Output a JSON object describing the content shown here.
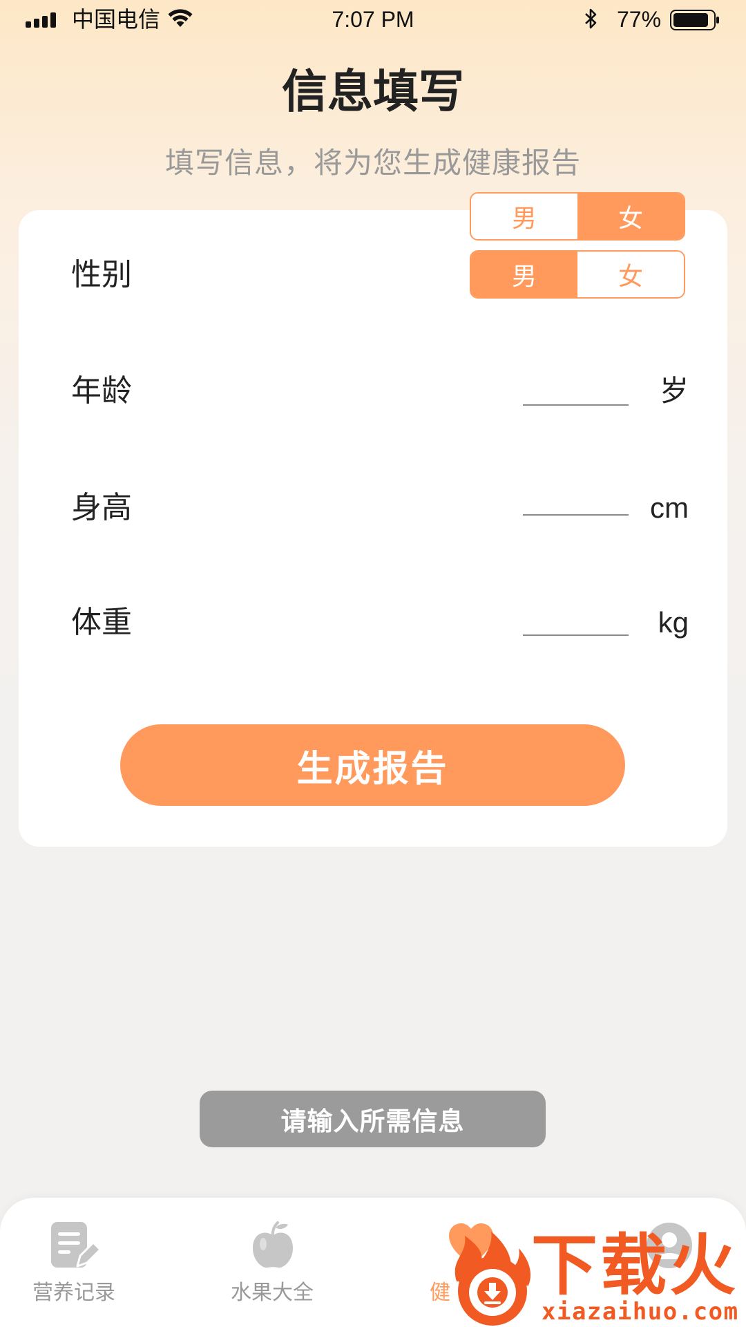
{
  "colors": {
    "accent": "#ff9a5c",
    "text": "#222222",
    "muted": "#999999",
    "toast_bg": "#9b9b9b",
    "watermark": "#f15a22",
    "inactive_icon": "#c6c6c6"
  },
  "status_bar": {
    "carrier": "中国电信",
    "time": "7:07 PM",
    "battery": "77%",
    "icons": [
      "signal-icon",
      "wifi-icon",
      "bluetooth-icon",
      "battery-icon"
    ]
  },
  "header": {
    "title": "信息填写",
    "subtitle": "填写信息，将为您生成健康报告"
  },
  "form": {
    "gender_toggle_overlay": {
      "options": [
        "男",
        "女"
      ],
      "selected": 1
    },
    "gender": {
      "label": "性别",
      "options": [
        "男",
        "女"
      ],
      "selected": 0
    },
    "age": {
      "label": "年龄",
      "value": "",
      "unit": "岁"
    },
    "height": {
      "label": "身高",
      "value": "",
      "unit": "cm"
    },
    "weight": {
      "label": "体重",
      "value": "",
      "unit": "kg"
    },
    "submit_label": "生成报告"
  },
  "toast": {
    "message": "请输入所需信息"
  },
  "tab_bar": {
    "items": [
      {
        "label": "营养记录",
        "icon": "note-edit-icon",
        "active": false
      },
      {
        "label": "水果大全",
        "icon": "apple-icon",
        "active": false
      },
      {
        "label": "健",
        "icon": "heart-icon",
        "active": true
      },
      {
        "icon": "avatar-icon",
        "active": false
      }
    ]
  },
  "watermark": {
    "brand": "下载火",
    "domain": "xiazaihuo.com"
  }
}
